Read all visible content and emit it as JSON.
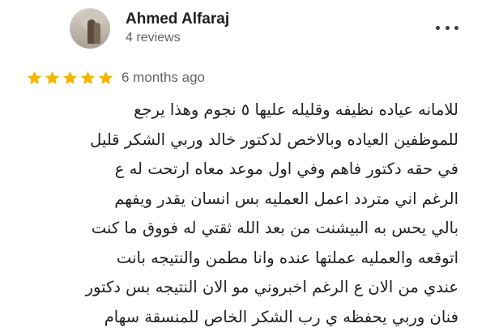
{
  "reviewer": {
    "name": "Ahmed Alfaraj",
    "reviews_count": "4 reviews"
  },
  "rating": {
    "stars": 5,
    "max": 5,
    "color": "#f4b400",
    "time_ago": "6 months ago"
  },
  "icons": {
    "menu": "more-vert-icon",
    "star": "star-icon"
  },
  "review": {
    "lines": [
      "للامانه عياده نظيفه وقليله عليها ٥ نجوم وهذا يرجع",
      "للموظفين العياده وبالاخص لدكتور خالد وربي الشكر قليل",
      "في حقه دكتور فاهم وفي اول موعد معاه ارتحت له ع",
      "الرغم اني متردد اعمل العمليه بس انسان يقدر ويفهم",
      "بالي يحس به البيشنت من بعد الله ثقتي له فووق ما كنت",
      "اتوقعه والعمليه عملتها عنده وانا مطمن والنتيجه بانت",
      "عندي من الان ع الرغم اخبروني مو الان النتيجه بس دكتور",
      "فنان وربي يحفظه ي رب الشكر الخاص للمنسقة سهام"
    ]
  }
}
